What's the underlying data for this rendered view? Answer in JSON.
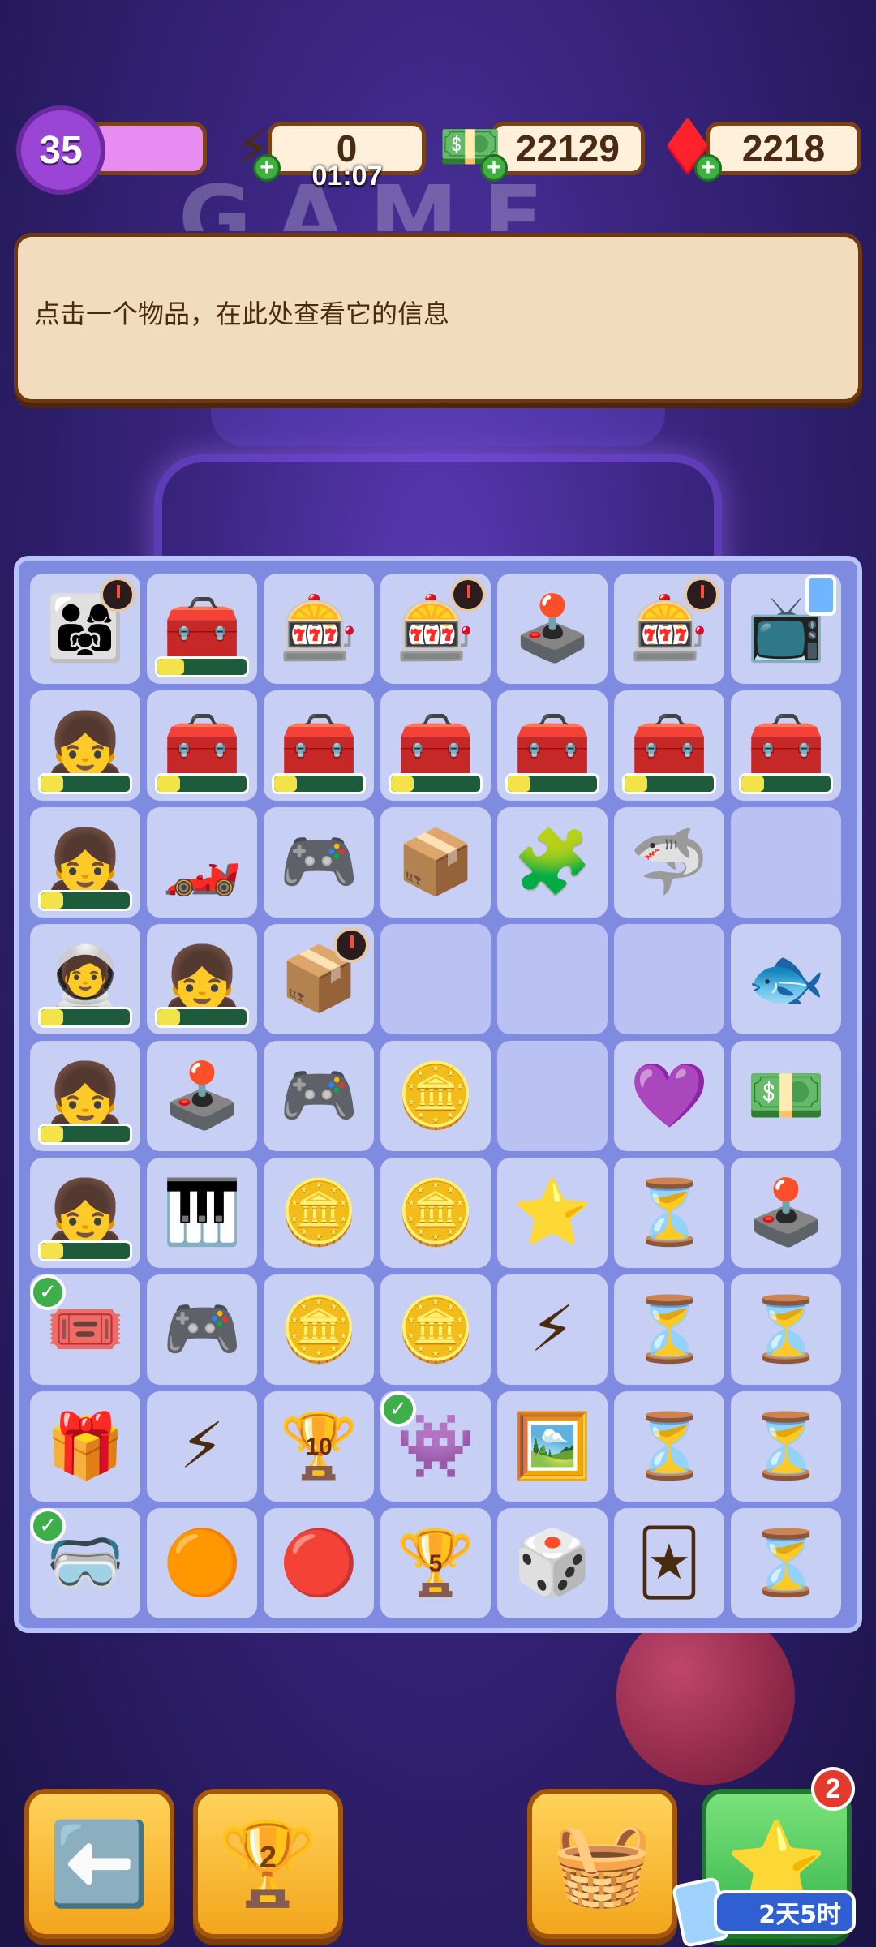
{
  "hud": {
    "level": "35",
    "energy": "0",
    "energy_timer": "01:07",
    "cash": "22129",
    "gems": "2218",
    "bg_sign": "GAME"
  },
  "info": {
    "text": "点击一个物品，在此处查看它的信息"
  },
  "board": {
    "cells": [
      {
        "icon": "👨‍👩‍👧",
        "name": "family-portrait-item",
        "clock": true
      },
      {
        "icon": "🧰",
        "name": "red-toolbox-item",
        "progress": 0.3
      },
      {
        "icon": "🎰",
        "name": "coin-case-item"
      },
      {
        "icon": "🎰",
        "name": "coin-case-item",
        "clock": true
      },
      {
        "icon": "🕹️",
        "name": "arcade-machine-item"
      },
      {
        "icon": "🎰",
        "name": "coin-case-item",
        "clock": true
      },
      {
        "icon": "📺",
        "name": "retro-tv-item",
        "phone": true
      },
      {
        "icon": "👧",
        "name": "gamer-girl-item",
        "progress": 0.25
      },
      {
        "icon": "🧰",
        "name": "red-toolbox-item",
        "progress": 0.25
      },
      {
        "icon": "🧰",
        "name": "red-toolbox-item",
        "progress": 0.25
      },
      {
        "icon": "🧰",
        "name": "red-toolbox-item",
        "progress": 0.25
      },
      {
        "icon": "🧰",
        "name": "red-toolbox-item",
        "progress": 0.25
      },
      {
        "icon": "🧰",
        "name": "red-toolbox-item",
        "progress": 0.25
      },
      {
        "icon": "🧰",
        "name": "red-toolbox-item",
        "progress": 0.25
      },
      {
        "icon": "👧",
        "name": "gamer-girl-item",
        "progress": 0.25
      },
      {
        "icon": "🏎️",
        "name": "race-car-item"
      },
      {
        "icon": "🎮",
        "name": "heart-console-item"
      },
      {
        "icon": "📦",
        "name": "cardboard-box-item"
      },
      {
        "icon": "🧩",
        "name": "purple-blob-item"
      },
      {
        "icon": "🦈",
        "name": "shark-item"
      },
      {
        "empty": true
      },
      {
        "icon": "🧑‍🚀",
        "name": "racer-item",
        "progress": 0.25
      },
      {
        "icon": "👧",
        "name": "gamer-girl-item",
        "progress": 0.25
      },
      {
        "icon": "📦",
        "name": "box-pile-item",
        "clock": true
      },
      {
        "empty": true
      },
      {
        "empty": true
      },
      {
        "empty": true
      },
      {
        "icon": "🐟",
        "name": "blue-fish-item"
      },
      {
        "icon": "👧",
        "name": "pigtail-girl-item",
        "progress": 0.25
      },
      {
        "icon": "🕹️",
        "name": "claw-machine-item"
      },
      {
        "icon": "🎮",
        "name": "handheld-console-item"
      },
      {
        "icon": "🪙",
        "name": "coin-stack-item"
      },
      {
        "empty": true
      },
      {
        "icon": "💜",
        "name": "purple-gem-item"
      },
      {
        "icon": "💵",
        "name": "cash-stack-item"
      },
      {
        "icon": "👧",
        "name": "gamer-girl-item",
        "progress": 0.25
      },
      {
        "icon": "🎹",
        "name": "dance-machine-item"
      },
      {
        "icon": "🪙",
        "name": "coin-stack-item"
      },
      {
        "icon": "🪙",
        "name": "coin-stack-item"
      },
      {
        "icon": "⭐",
        "name": "purple-star-item"
      },
      {
        "icon": "⏳",
        "name": "orange-hourglass-item"
      },
      {
        "icon": "🕹️",
        "name": "joystick-item"
      },
      {
        "icon": "🎟️",
        "name": "ticket-item",
        "check": true
      },
      {
        "icon": "🎮",
        "name": "gamepad-item"
      },
      {
        "icon": "🪙",
        "name": "coin-stack-item"
      },
      {
        "icon": "🪙",
        "name": "coin-stack-item"
      },
      {
        "icon": "⚡",
        "name": "blue-energy-orb-item"
      },
      {
        "icon": "⏳",
        "name": "blue-hourglass-item"
      },
      {
        "icon": "⏳",
        "name": "blue-hourglass-item"
      },
      {
        "icon": "🎁",
        "name": "toy-bundle-item"
      },
      {
        "icon": "⚡",
        "name": "blue-energy-orb-item"
      },
      {
        "icon": "🏆",
        "name": "trophy-10-item",
        "num": "10"
      },
      {
        "icon": "👾",
        "name": "orange-ghost-item",
        "check": true
      },
      {
        "icon": "🖼️",
        "name": "purple-card-item"
      },
      {
        "icon": "⏳",
        "name": "orange-hourglass-item"
      },
      {
        "icon": "⏳",
        "name": "red-hourglass-item"
      },
      {
        "icon": "🥽",
        "name": "vr-headset-item",
        "check": true
      },
      {
        "icon": "🟠",
        "name": "orange-energy-orb-item"
      },
      {
        "icon": "🔴",
        "name": "red-energy-orb-item"
      },
      {
        "icon": "🏆",
        "name": "trophy-5-item",
        "num": "5"
      },
      {
        "icon": "🎲",
        "name": "mystery-box-item"
      },
      {
        "icon": "🃏",
        "name": "game-card-item"
      },
      {
        "icon": "⏳",
        "name": "blue-hourglass-item"
      }
    ]
  },
  "bottom": {
    "trophy_count": "2",
    "star_badge": "2",
    "event_timer": "2天5时"
  }
}
